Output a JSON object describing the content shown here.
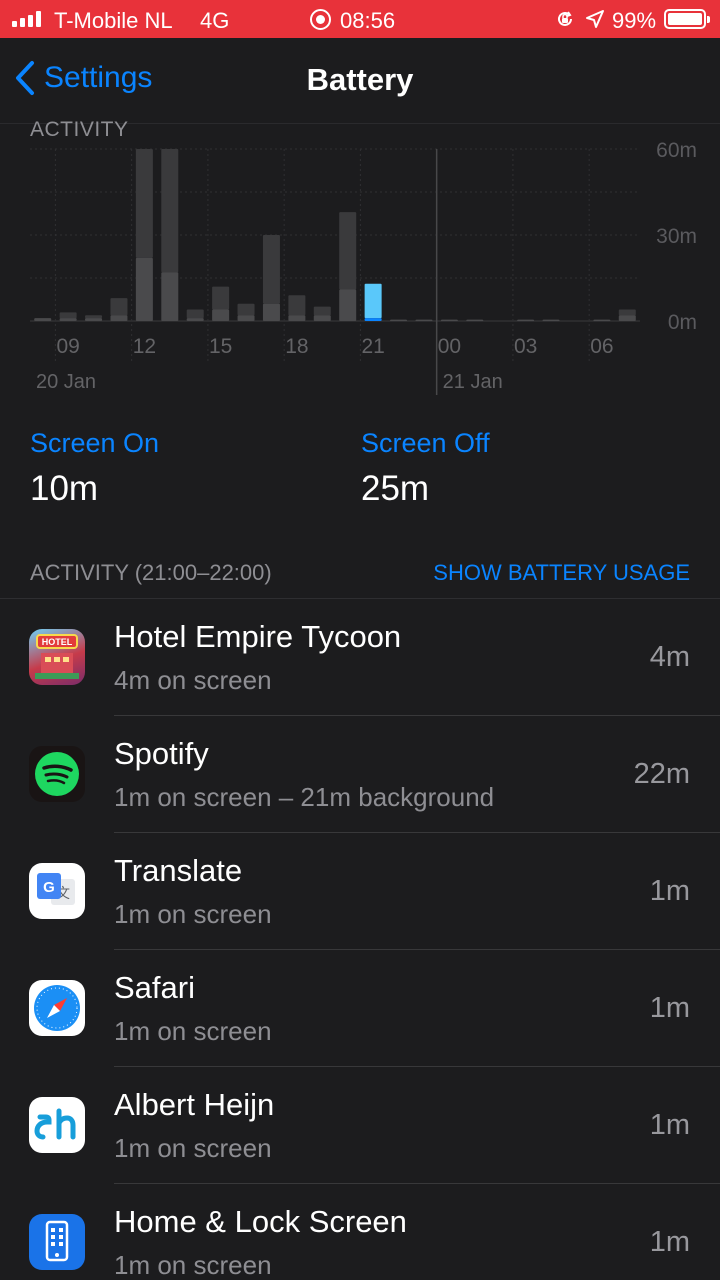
{
  "status_bar": {
    "carrier": "T-Mobile NL",
    "network": "4G",
    "time": "08:56",
    "battery_percent": "99%"
  },
  "nav": {
    "back_label": "Settings",
    "title": "Battery"
  },
  "section_peek": "ACTIVITY",
  "chart_data": {
    "type": "bar",
    "y_tick_labels": [
      "60m",
      "30m",
      "0m"
    ],
    "ylim": [
      0,
      60
    ],
    "x_tick_labels": [
      "09",
      "12",
      "15",
      "18",
      "21",
      "00",
      "03",
      "06"
    ],
    "date_labels": [
      "20 Jan",
      "21 Jan"
    ],
    "hours": [
      "08",
      "09",
      "10",
      "11",
      "12",
      "13",
      "14",
      "15",
      "16",
      "17",
      "18",
      "19",
      "20",
      "21",
      "22",
      "23",
      "00",
      "01",
      "02",
      "03",
      "04",
      "05",
      "06",
      "07"
    ],
    "screen_on": [
      1,
      1,
      1,
      2,
      22,
      17,
      1,
      4,
      2,
      6,
      2,
      2,
      11,
      1,
      0.5,
      0.5,
      0.5,
      0.5,
      0,
      0.5,
      0.5,
      0,
      0.5,
      2
    ],
    "screen_off": [
      0,
      2,
      1,
      6,
      38,
      43,
      3,
      8,
      4,
      24,
      7,
      3,
      27,
      12,
      0,
      0,
      0,
      0,
      0,
      0,
      0,
      0,
      0,
      2
    ],
    "selected_hour": "21",
    "colors": {
      "unselected_on": "#4a4a4c",
      "unselected_off": "#3a3a3c",
      "selected_on": "#0a84ff",
      "selected_off": "#5ac8fa"
    }
  },
  "stats": {
    "screen_on_label": "Screen On",
    "screen_on_value": "10m",
    "screen_off_label": "Screen Off",
    "screen_off_value": "25m"
  },
  "activity": {
    "header": "ACTIVITY (21:00–22:00)",
    "action": "SHOW BATTERY USAGE",
    "apps": [
      {
        "icon": "hotel-empire-tycoon-icon",
        "name": "Hotel Empire Tycoon",
        "detail": "4m on screen",
        "usage": "4m"
      },
      {
        "icon": "spotify-icon",
        "name": "Spotify",
        "detail": "1m on screen – 21m background",
        "usage": "22m"
      },
      {
        "icon": "translate-icon",
        "name": "Translate",
        "detail": "1m on screen",
        "usage": "1m"
      },
      {
        "icon": "safari-icon",
        "name": "Safari",
        "detail": "1m on screen",
        "usage": "1m"
      },
      {
        "icon": "albert-heijn-icon",
        "name": "Albert Heijn",
        "detail": "1m on screen",
        "usage": "1m"
      },
      {
        "icon": "home-lock-screen-icon",
        "name": "Home & Lock Screen",
        "detail": "1m on screen",
        "usage": "1m"
      }
    ]
  },
  "icon_label": {
    "hotel": "HOTEL"
  },
  "accent_color": "#0a84ff"
}
